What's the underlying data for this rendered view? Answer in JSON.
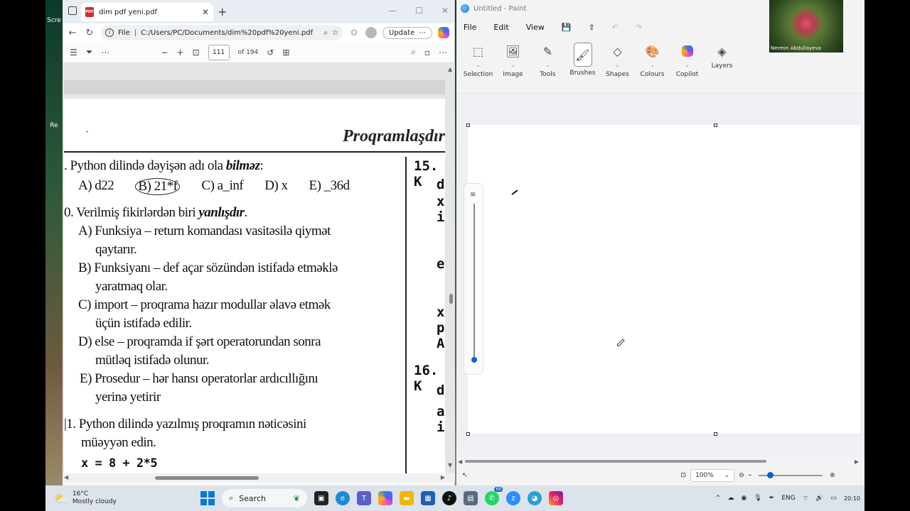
{
  "desktop": {
    "icons": [
      "Scre",
      "Re"
    ]
  },
  "edge": {
    "tab_title": "dim pdf yeni.pdf",
    "pdf_badge": "PDF",
    "address_prefix": "File",
    "address": "C:/Users/PC/Documents/dim%20pdf%20yeni.pdf",
    "update_label": "Update",
    "page_current": "111",
    "page_total": "of 194"
  },
  "pdf_page": {
    "header": "Proqramlaşdır",
    "stray_mark": "˰",
    "q9_text_pre": ". Python dilində dəyişən adı ola ",
    "q9_text_bold": "bilməz",
    "q9_text_post": ":",
    "q9_options": [
      "A) d22",
      "B) 21*f",
      "C) a_inf",
      "D) x",
      "E) _36d"
    ],
    "q10_pre": "0. Verilmiş fikirlərdən biri ",
    "q10_bold": "yanlışdır",
    "q10_post": ".",
    "q10_lines": [
      "A) Funksiya – return komandası vasitəsilə qiymət",
      "qaytarır.",
      "B) Funksiyanı – def açar sözündən istifadə etməklə",
      "yaratmaq olar.",
      "C) import – proqrama hazır modullar əlavə etmək",
      "üçün istifadə edilir.",
      "D) else – proqramda if şərt operatorundan sonra",
      "mütləq istifadə olunur.",
      "E) Prosedur – hər hansı operatorlar ardıcıllığını",
      "yerinə yetirir"
    ],
    "q11_line1": "|1. Python dilində yazılmış proqramın nəticəsini",
    "q11_line2": "müəyyən edin.",
    "q11_code": "x = 8 + 2*5",
    "right_column": [
      "15. K",
      "d",
      "x",
      "i",
      "e",
      "x",
      "p",
      "A",
      "16. K",
      "d",
      "a",
      "i"
    ]
  },
  "paint": {
    "title": "Untitled - Paint",
    "menu": [
      "File",
      "Edit",
      "View"
    ],
    "ribbon": [
      "Selection",
      "Image",
      "Tools",
      "Brushes",
      "Shapes",
      "Colours",
      "Copilot",
      "Layers"
    ],
    "zoom": "100%"
  },
  "webcam": {
    "name": "Nermin Abdullayeva"
  },
  "taskbar": {
    "temp": "16°C",
    "weather": "Mostly cloudy",
    "search": "Search",
    "badge": "69",
    "lang": "ENG",
    "time": "20:10"
  }
}
